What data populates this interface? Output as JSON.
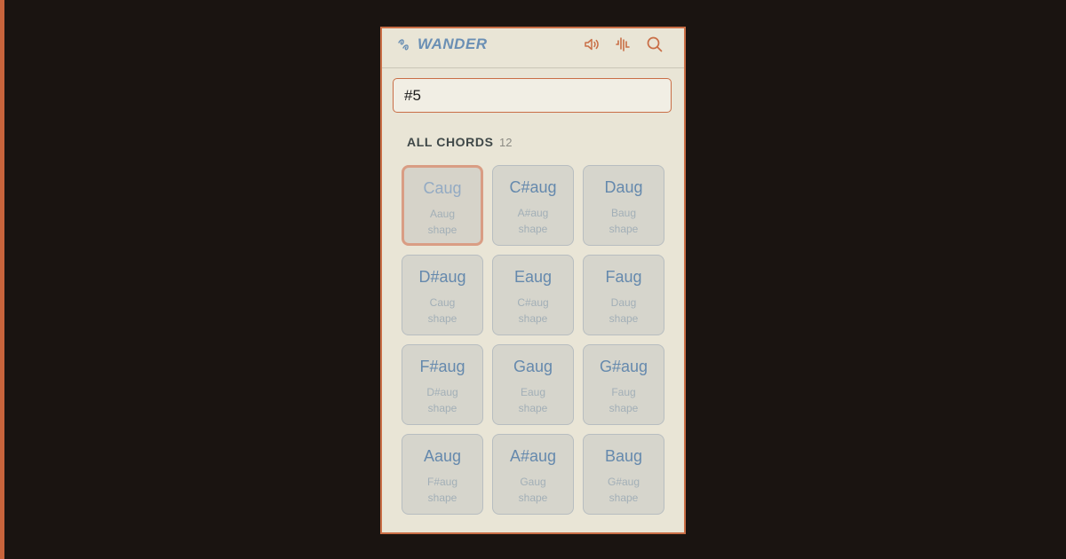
{
  "app": {
    "title": "WANDER",
    "colors": {
      "accent": "#c96e46",
      "brand": "#6a8fb4",
      "background": "#1a1411",
      "panel": "#e9e5d6"
    }
  },
  "toolbar": {
    "icons": [
      "speaker-icon",
      "waveform-icon",
      "search-icon"
    ]
  },
  "search": {
    "value": "#5",
    "placeholder": ""
  },
  "section": {
    "title": "ALL CHORDS",
    "count": "12"
  },
  "chords": [
    {
      "name": "Caug",
      "shape_name": "Aaug",
      "shape_label": "shape",
      "selected": true
    },
    {
      "name": "C#aug",
      "shape_name": "A#aug",
      "shape_label": "shape"
    },
    {
      "name": "Daug",
      "shape_name": "Baug",
      "shape_label": "shape"
    },
    {
      "name": "D#aug",
      "shape_name": "Caug",
      "shape_label": "shape"
    },
    {
      "name": "Eaug",
      "shape_name": "C#aug",
      "shape_label": "shape"
    },
    {
      "name": "Faug",
      "shape_name": "Daug",
      "shape_label": "shape"
    },
    {
      "name": "F#aug",
      "shape_name": "D#aug",
      "shape_label": "shape"
    },
    {
      "name": "Gaug",
      "shape_name": "Eaug",
      "shape_label": "shape"
    },
    {
      "name": "G#aug",
      "shape_name": "Faug",
      "shape_label": "shape"
    },
    {
      "name": "Aaug",
      "shape_name": "F#aug",
      "shape_label": "shape"
    },
    {
      "name": "A#aug",
      "shape_name": "Gaug",
      "shape_label": "shape"
    },
    {
      "name": "Baug",
      "shape_name": "G#aug",
      "shape_label": "shape"
    }
  ]
}
